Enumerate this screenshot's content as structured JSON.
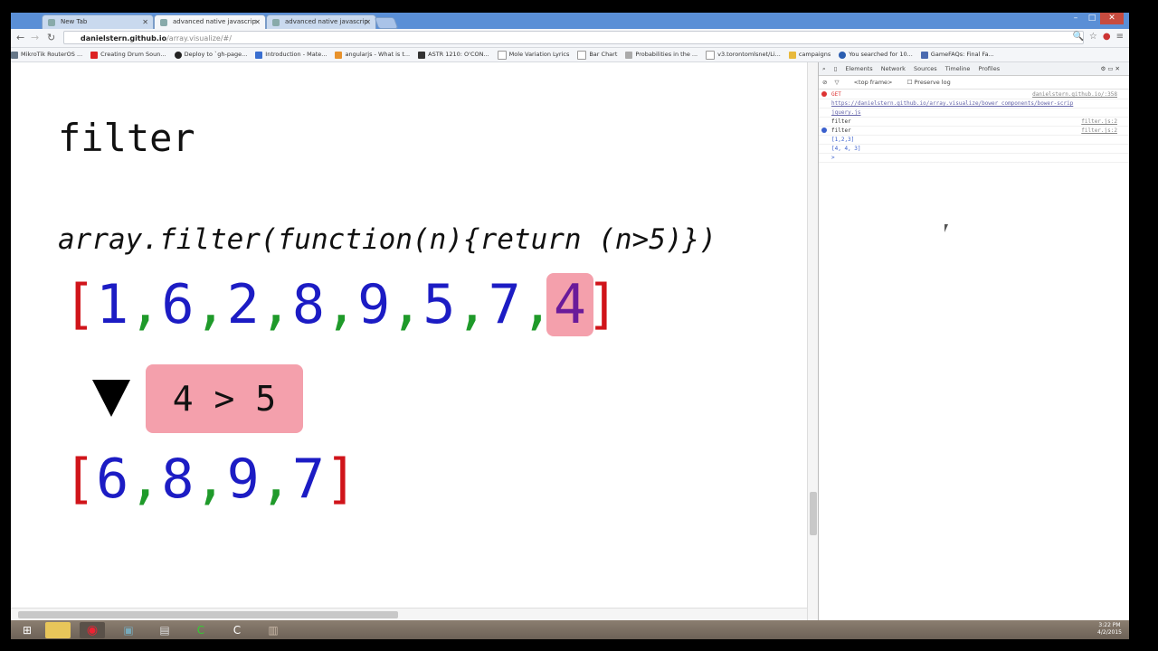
{
  "browser": {
    "tabs": [
      {
        "label": "New Tab",
        "active": false
      },
      {
        "label": "advanced native javascrip",
        "active": true
      },
      {
        "label": "advanced native javascrip",
        "active": false
      }
    ],
    "url_host": "danielstern.github.io",
    "url_path": "/array.visualize/#/",
    "bookmarks": [
      "MikroTik RouterOS ...",
      "Creating Drum Soun...",
      "Deploy to `gh-page...",
      "Introduction - Mate...",
      "angularjs - What is t...",
      "ASTR 1210: O'CON...",
      "Mole Variation Lyrics",
      "Bar Chart",
      "Probabilities in the ...",
      "v3.torontomlsnet/Li...",
      "campaigns",
      "You searched for 10...",
      "GameFAQs: Final Fa..."
    ]
  },
  "visualization": {
    "title": "filter",
    "code": "array.filter(function(n){return (n>5)})",
    "input_array": [
      "1",
      "6",
      "2",
      "8",
      "9",
      "5",
      "7",
      "4"
    ],
    "highlight_index": 7,
    "comparison": "4 > 5",
    "output_array": [
      "6",
      "8",
      "9",
      "7"
    ],
    "open_bracket": "[",
    "close_bracket": "]",
    "separator": ","
  },
  "devtools": {
    "tabs": [
      "Elements",
      "Network",
      "Sources",
      "Timeline",
      "Profiles"
    ],
    "frame": "<top frame>",
    "preserve_log": "Preserve log",
    "console": {
      "line1_left": "GET",
      "line1_link": "danielstern.github.io/:358",
      "line2": "https://danielstern.github.io/array.visualize/bower_components/bower-scrip",
      "line3": "jquery.js",
      "line4_left": "filter",
      "line4_right": "filter.js:2",
      "line5_left": "filter",
      "line5_right": "filter.js:2",
      "line6": "[1,2,3]",
      "line7": "[4, 4, 3]",
      "prompt": ">"
    }
  },
  "taskbar": {
    "time": "3:22 PM",
    "date": "4/2/2015"
  }
}
